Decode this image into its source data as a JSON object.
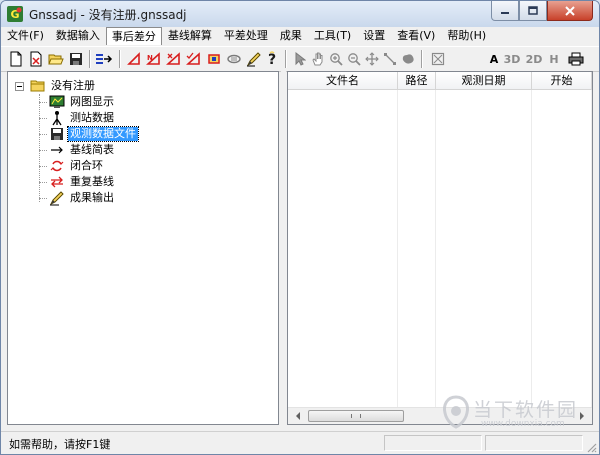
{
  "window": {
    "title": "Gnssadj - 没有注册.gnssadj"
  },
  "menubar": {
    "items": [
      "文件(F)",
      "数据输入",
      "事后差分",
      "基线解算",
      "平差处理",
      "成果",
      "工具(T)",
      "设置",
      "查看(V)",
      "帮助(H)"
    ],
    "active_index": 2
  },
  "toolbar": {
    "text_buttons": [
      "A",
      "3D",
      "2D",
      "H"
    ]
  },
  "tree": {
    "root": "没有注册",
    "items": [
      "网图显示",
      "测站数据",
      "观测数据文件",
      "基线简表",
      "闭合环",
      "重复基线",
      "成果输出"
    ],
    "selected_index": 2
  },
  "table": {
    "columns": [
      "文件名",
      "路径",
      "观测日期",
      "开始"
    ]
  },
  "statusbar": {
    "text": "如需帮助，请按F1键"
  },
  "watermark": {
    "title": "当下软件园",
    "url": "www.downxia.com"
  },
  "colors": {
    "selection": "#3399ff",
    "close_button": "#c8412a",
    "accent_red": "#d81e1e"
  }
}
